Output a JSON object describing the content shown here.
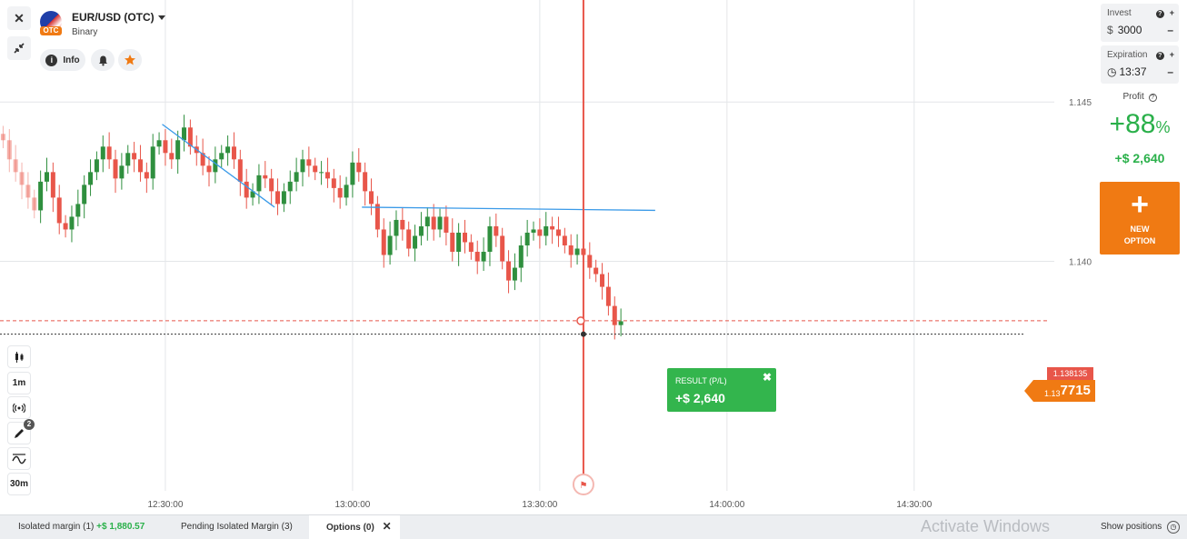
{
  "asset": {
    "name": "EUR/USD (OTC)",
    "type": "Binary",
    "badge": "OTC"
  },
  "toolbar": {
    "close_icon": "close-icon",
    "collapse_icon": "collapse-arrows-icon",
    "info_label": "Info",
    "info_glyph": "i",
    "close_glyph": "✕"
  },
  "left_tools": {
    "chart_type_icon": "candles-icon",
    "timeframe": "1m",
    "indicators_icon": "broadcast-icon",
    "drawing_badge": "2",
    "drawing_icon": "pencil-icon",
    "wave_icon": "wave-icon",
    "period": "30m"
  },
  "chart_data": {
    "type": "candlestick",
    "instrument": "EUR/USD (OTC)",
    "y_ticks": [
      "1.145",
      "1.140"
    ],
    "y_tick_values": [
      1.145,
      1.14
    ],
    "x_ticks": [
      "12:30:00",
      "13:00:00",
      "13:30:00",
      "14:00:00",
      "14:30:00"
    ],
    "x_tick_minutes": [
      750,
      780,
      810,
      840,
      870
    ],
    "ylim": [
      1.1328,
      1.1482
    ],
    "xlim_minutes": [
      723.5,
      891
    ],
    "open_price_label": "1.138135",
    "open_price": 1.138135,
    "current_price_prefix": "1.13",
    "current_price_suffix": "7715",
    "current_price": 1.137715,
    "expiration_time_minutes": 817,
    "trendlines": [
      {
        "from": {
          "t": 749.5,
          "p": 1.1443
        },
        "to": {
          "t": 767.5,
          "p": 1.1417
        }
      },
      {
        "from": {
          "t": 781.5,
          "p": 1.1417
        },
        "to": {
          "t": 828.5,
          "p": 1.1416
        }
      }
    ],
    "candle_interval_minutes": 1,
    "first_candle_minute": 724,
    "candles_close": [
      1.1438,
      1.1432,
      1.1428,
      1.1424,
      1.142,
      1.1416,
      1.1425,
      1.1428,
      1.142,
      1.1412,
      1.141,
      1.1414,
      1.1418,
      1.1424,
      1.1428,
      1.1432,
      1.1436,
      1.1432,
      1.1426,
      1.143,
      1.1434,
      1.1432,
      1.1428,
      1.1426,
      1.1436,
      1.1438,
      1.1434,
      1.1432,
      1.1438,
      1.1442,
      1.1436,
      1.1434,
      1.143,
      1.1428,
      1.1432,
      1.1434,
      1.1436,
      1.1432,
      1.1425,
      1.142,
      1.1422,
      1.1427,
      1.1426,
      1.1422,
      1.1418,
      1.1422,
      1.1425,
      1.1428,
      1.1432,
      1.143,
      1.1428,
      1.1428,
      1.1426,
      1.1423,
      1.142,
      1.1424,
      1.1431,
      1.1428,
      1.1422,
      1.1418,
      1.141,
      1.1402,
      1.1408,
      1.1413,
      1.141,
      1.1404,
      1.1408,
      1.1411,
      1.1414,
      1.141,
      1.1414,
      1.1409,
      1.1403,
      1.1409,
      1.1406,
      1.1403,
      1.14,
      1.1403,
      1.1411,
      1.1408,
      1.14,
      1.1394,
      1.1398,
      1.1405,
      1.1409,
      1.141,
      1.1408,
      1.1411,
      1.141,
      1.1408,
      1.1405,
      1.1402,
      1.1404,
      1.1402,
      1.1398,
      1.1396,
      1.1392,
      1.1386,
      1.138,
      1.13812
    ],
    "candles_open": [
      1.144,
      1.1438,
      1.1432,
      1.1428,
      1.1424,
      1.142,
      1.1416,
      1.1425,
      1.1428,
      1.142,
      1.1412,
      1.141,
      1.1414,
      1.1418,
      1.1424,
      1.1428,
      1.1432,
      1.1436,
      1.1432,
      1.1426,
      1.143,
      1.1434,
      1.1432,
      1.1428,
      1.1426,
      1.1436,
      1.1438,
      1.1434,
      1.1432,
      1.1438,
      1.1442,
      1.1436,
      1.1434,
      1.143,
      1.1428,
      1.1432,
      1.1434,
      1.1436,
      1.1432,
      1.1425,
      1.142,
      1.1422,
      1.1427,
      1.1426,
      1.1422,
      1.1418,
      1.1422,
      1.1425,
      1.1428,
      1.1432,
      1.143,
      1.1428,
      1.1428,
      1.1426,
      1.1423,
      1.142,
      1.1424,
      1.1431,
      1.1428,
      1.1422,
      1.1418,
      1.141,
      1.1402,
      1.1408,
      1.1413,
      1.141,
      1.1404,
      1.1408,
      1.1411,
      1.1414,
      1.141,
      1.1414,
      1.1409,
      1.1403,
      1.1409,
      1.1406,
      1.1403,
      1.14,
      1.1403,
      1.1411,
      1.1408,
      1.14,
      1.1394,
      1.1398,
      1.1405,
      1.1409,
      1.141,
      1.1408,
      1.1411,
      1.141,
      1.1408,
      1.1405,
      1.1402,
      1.1404,
      1.1402,
      1.1398,
      1.1396,
      1.1392,
      1.1386,
      1.138
    ]
  },
  "right_panel": {
    "invest_label": "Invest",
    "invest_currency": "$",
    "invest_value": "3000",
    "expiration_label": "Expiration",
    "expiration_value": "13:37",
    "help_glyph": "?",
    "plus_glyph": "+",
    "minus_glyph": "–",
    "clock_glyph": "◷",
    "profit_label": "Profit",
    "profit_info_glyph": "?",
    "profit_percent": "+88",
    "profit_percent_sign": "%",
    "profit_amount": "+$ 2,640",
    "new_option_line1": "NEW",
    "new_option_line2": "OPTION",
    "new_option_glyph": "+"
  },
  "result": {
    "title": "RESULT (P/L)",
    "value": "+$ 2,640",
    "close_glyph": "✖"
  },
  "bottom_bar": {
    "tab1_label": "Isolated margin",
    "tab1_count": "(1)",
    "tab1_value": "+$ 1,880.57",
    "tab2_label": "Pending Isolated Margin",
    "tab2_count": "(3)",
    "tab3_label": "Options",
    "tab3_count": "(0)",
    "tab3_close": "✕",
    "watermark": "Activate Windows",
    "show_positions": "Show positions",
    "show_positions_icon": "◷"
  },
  "colors": {
    "up": "#2f8f3e",
    "down": "#e8564a",
    "accent": "#f07a13",
    "profit": "#2ab04a",
    "trendline": "#3a9ae8"
  }
}
